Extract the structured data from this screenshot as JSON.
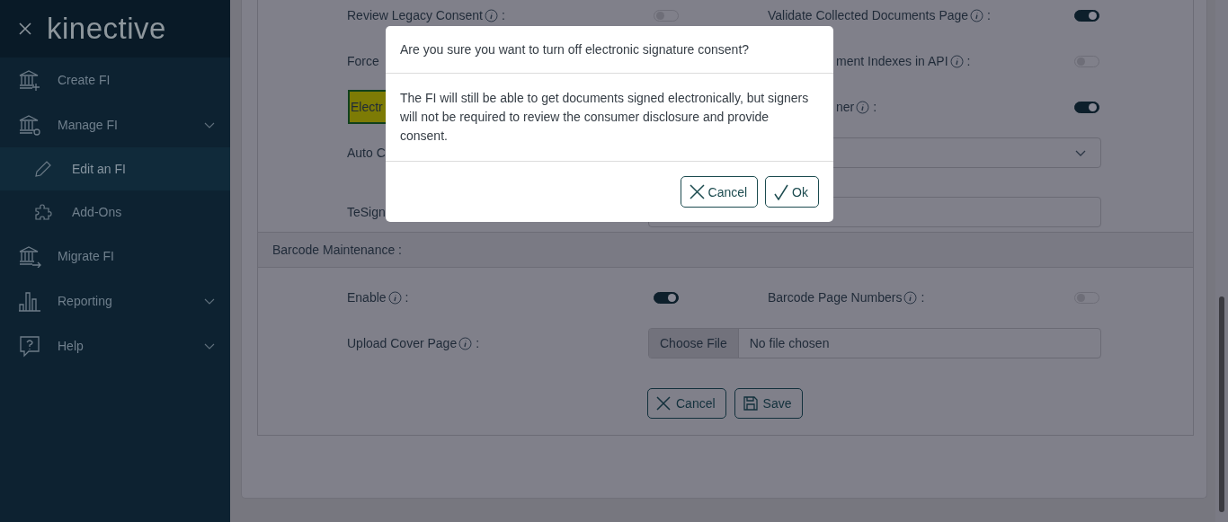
{
  "sidebar": {
    "logo": "kinective",
    "items": [
      {
        "label": "Create FI",
        "has_submenu": false
      },
      {
        "label": "Manage FI",
        "has_submenu": true,
        "children": [
          {
            "label": "Edit an FI",
            "selected": true
          },
          {
            "label": "Add-Ons",
            "selected": false
          }
        ]
      },
      {
        "label": "Migrate FI",
        "has_submenu": false
      },
      {
        "label": "Reporting",
        "has_submenu": true
      },
      {
        "label": "Help",
        "has_submenu": true
      }
    ]
  },
  "settings": {
    "rows": [
      {
        "left": {
          "label": "Review Legacy Consent",
          "info": true,
          "suffix": ":",
          "kind": "toggle",
          "on": false
        },
        "right": {
          "label": "Validate Collected Documents Page",
          "info": true,
          "suffix": ":",
          "kind": "toggle",
          "on": true
        }
      },
      {
        "left": {
          "label": "Force"
        },
        "right": {
          "label": "ment Indexes in API",
          "clipped": true,
          "info": true,
          "suffix": ":",
          "kind": "toggle",
          "on": false
        }
      },
      {
        "left": {
          "label": "Electr",
          "highlighted": true
        },
        "right": {
          "label": "ner",
          "clipped": true,
          "info": true,
          "suffix": ":",
          "kind": "toggle",
          "on": true
        }
      },
      {
        "left": {
          "label": "Auto C"
        },
        "field": {
          "kind": "select"
        }
      },
      {
        "left": {
          "label": "TeSign"
        },
        "field": {
          "kind": "input"
        }
      }
    ]
  },
  "barcode": {
    "title": "Barcode Maintenance :",
    "rows": [
      {
        "left": {
          "label": "Enable",
          "info": true,
          "suffix": ":",
          "kind": "toggle",
          "on": true
        },
        "right": {
          "label": "Barcode Page Numbers",
          "info": true,
          "suffix": ":",
          "kind": "toggle",
          "on": false
        }
      },
      {
        "left": {
          "label": "Upload Cover Page",
          "info": true,
          "suffix": ":"
        },
        "field": {
          "kind": "file",
          "button": "Choose File",
          "value": "No file chosen"
        }
      }
    ],
    "buttons": [
      {
        "label": "Cancel",
        "kind": "cancel"
      },
      {
        "label": "Save",
        "kind": "save"
      }
    ]
  },
  "dialog": {
    "title": "Are you sure you want to turn off electronic signature consent?",
    "message": "The FI will still be able to get documents signed electronically, but signers will not be required to review the consumer disclosure and provide consent.",
    "buttons": [
      {
        "label": "Cancel",
        "kind": "cancel"
      },
      {
        "label": "Ok",
        "kind": "ok"
      }
    ]
  }
}
